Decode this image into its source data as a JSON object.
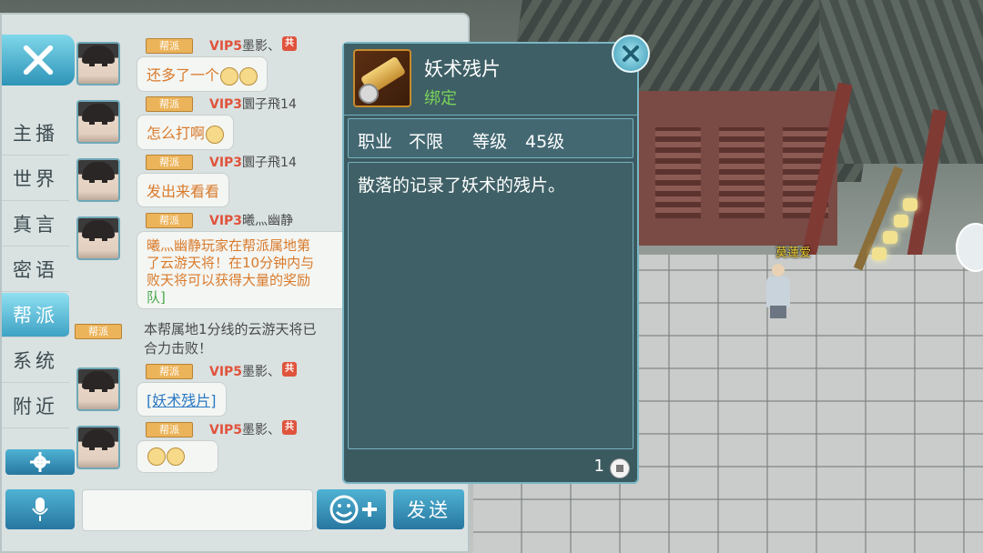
{
  "world": {
    "npc_name": "莫蓮爱"
  },
  "chat": {
    "tabs": [
      {
        "label": "主播"
      },
      {
        "label": "世界"
      },
      {
        "label": "真言"
      },
      {
        "label": "密语"
      },
      {
        "label": "帮派",
        "active": true
      },
      {
        "label": "系统"
      },
      {
        "label": "附近"
      }
    ],
    "messages": [
      {
        "badge": "帮派",
        "vip": "VIP5",
        "nick": "墨影、",
        "gong": "共",
        "text": "还多了一个"
      },
      {
        "badge": "帮派",
        "vip": "VIP3",
        "nick": "圜子飛14",
        "text": "怎么打啊"
      },
      {
        "badge": "帮派",
        "vip": "VIP3",
        "nick": "圜子飛14",
        "text": "发出来看看"
      },
      {
        "badge": "帮派",
        "vip": "VIP3",
        "nick": "曦灬幽静",
        "text_lines": [
          "曦灬幽静玩家在帮派属地第",
          "了云游天将！在10分钟内与",
          "败天将可以获得大量的奖励"
        ],
        "green_tail": "队]"
      },
      {
        "badge": "帮派",
        "vip": "VIP5",
        "nick": "墨影、",
        "gong": "共",
        "text": "[妖术残片]"
      },
      {
        "badge": "帮派",
        "vip": "VIP5",
        "nick": "墨影、",
        "gong": "共",
        "text": ""
      }
    ],
    "notice": {
      "badge": "帮派",
      "lines": [
        "本帮属地1分线的云游天将已",
        "合力击败！"
      ]
    },
    "send_label": "发送"
  },
  "item": {
    "name": "妖术残片",
    "bind": "绑定",
    "class_label": "职业",
    "class_value": "不限",
    "level_label": "等级",
    "level_value": "45级",
    "description": "散落的记录了妖术的残片。",
    "count": "1"
  }
}
